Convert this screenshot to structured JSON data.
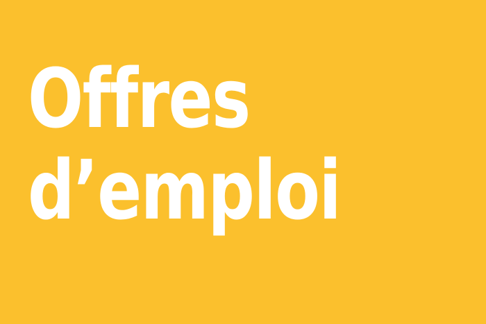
{
  "banner": {
    "background_color": "#FBC02D",
    "text_color": "#FFFFFF",
    "headline_line1": "Offres",
    "headline_line2": "d’emploi"
  }
}
